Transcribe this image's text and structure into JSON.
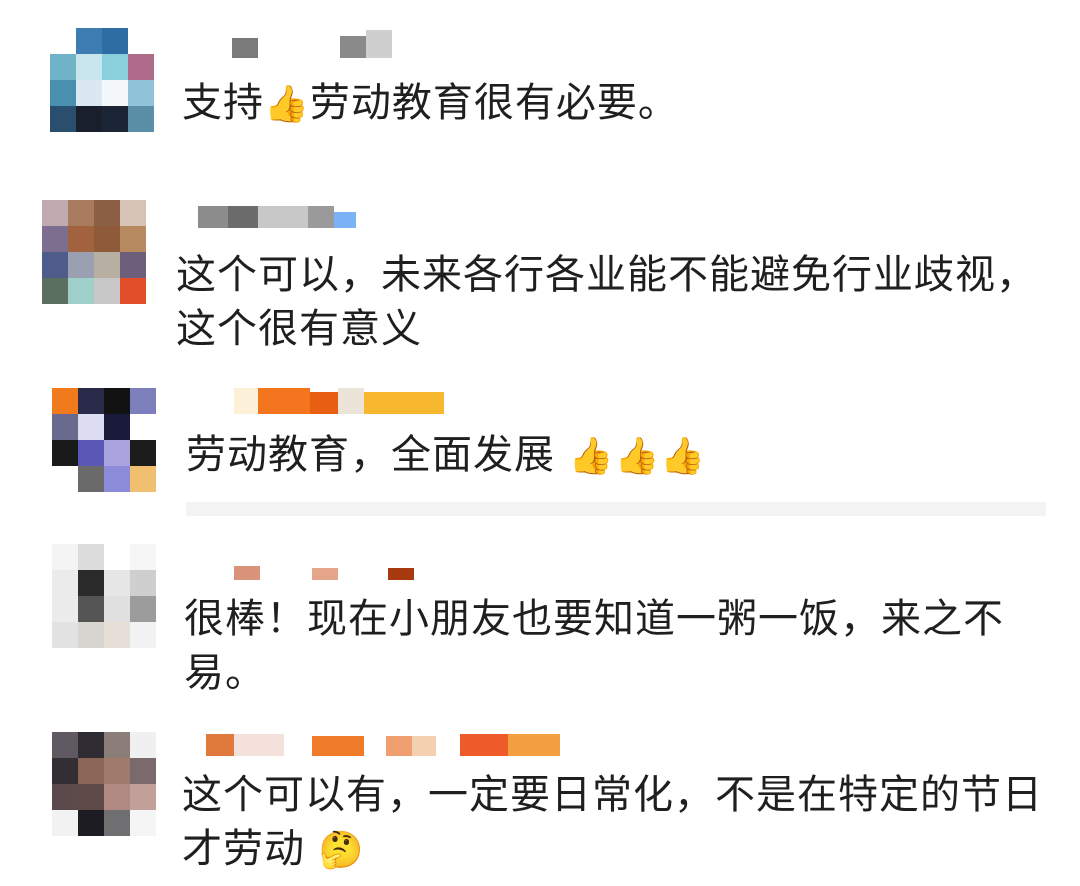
{
  "comments": [
    {
      "avatar_colors": [
        "#ffffff",
        "#3d7db2",
        "#2e6ca4",
        "#ffffff",
        "#6fb3c8",
        "#c8e4ec",
        "#8ad0dc",
        "#b06a8a",
        "#4a8fb0",
        "#dbe7f1",
        "#f5f8fb",
        "#90c2da",
        "#2a4e6d",
        "#1a1f2d",
        "#1c2535",
        "#5b8fa8"
      ],
      "username_blocks": [
        "#7a7a7a",
        "#ffffff",
        "#8a8a8a",
        "#cfcfcf"
      ],
      "text_before": "支持",
      "emoji": "👍",
      "text_after": "劳动教育很有必要。"
    },
    {
      "avatar_colors": [
        "#c1a9b0",
        "#a87b5f",
        "#8a5f43",
        "#d6c3b5",
        "#7d6d8f",
        "#a2623e",
        "#8f5a3a",
        "#b88a5f",
        "#4f5b8a",
        "#9aa0b1",
        "#b7b0a2",
        "#6d5f7c",
        "#5b6f5e",
        "#9fcfc9",
        "#c7c7c7",
        "#e24e2a"
      ],
      "username_blocks": [
        "#8c8c8c",
        "#6c6c6c",
        "#c8c8c8",
        "#9a9a9a",
        "#7ab2f5"
      ],
      "text": "这个可以，未来各行各业能不能避免行业歧视，\n这个很有意义"
    },
    {
      "avatar_colors": [
        "#f07a1c",
        "#2a2a4a",
        "#121212",
        "#7d7fbd",
        "#6a6a8e",
        "#dcdcf2",
        "#1a1a3a",
        "#ffffff",
        "#1a1a1a",
        "#5b58b5",
        "#a9a3e0",
        "#1c1c1c",
        "#ffffff",
        "#6a6a6a",
        "#8b8bd9",
        "#f0c070"
      ],
      "username_blocks": [
        "#fdf0d8",
        "#f3761e",
        "#e85f12",
        "#ece4d8",
        "#f7b830"
      ],
      "text": "劳动教育，全面发展",
      "emoji_trailing": "👍👍👍"
    },
    {
      "avatar_colors": [
        "#f4f4f4",
        "#dcdcdc",
        "#ffffff",
        "#f6f6f6",
        "#ebebeb",
        "#2b2b2b",
        "#e6e6e6",
        "#cfcfcf",
        "#ececec",
        "#555555",
        "#e0e0e0",
        "#9c9c9c",
        "#e2e2e2",
        "#d8d4d0",
        "#e6dfd8",
        "#f2f2f2"
      ],
      "username_blocks": [
        "#d8937a",
        "#e4a58a",
        "#a93a10"
      ],
      "text": "很棒！现在小朋友也要知道一粥一饭，来之不\n易。"
    },
    {
      "avatar_colors": [
        "#5f5a62",
        "#2f2b33",
        "#8b7d77",
        "#f0f0f0",
        "#332e33",
        "#8a6656",
        "#a07a6a",
        "#7a6a6c",
        "#5a4a4c",
        "#5e4a46",
        "#b08a80",
        "#c0a098",
        "#f2f2f2",
        "#1c1c22",
        "#6f6f72",
        "#f5f5f5"
      ],
      "username_blocks": [
        "#e07a3c",
        "#f5e1dc",
        "#ef7a2a",
        "#f0a070",
        "#f5d0b0",
        "#ef5a2a",
        "#f5a040"
      ],
      "text": "这个可以有，一定要日常化，不是在特定的节日\n才劳动",
      "emoji_trailing": "🤔"
    }
  ]
}
